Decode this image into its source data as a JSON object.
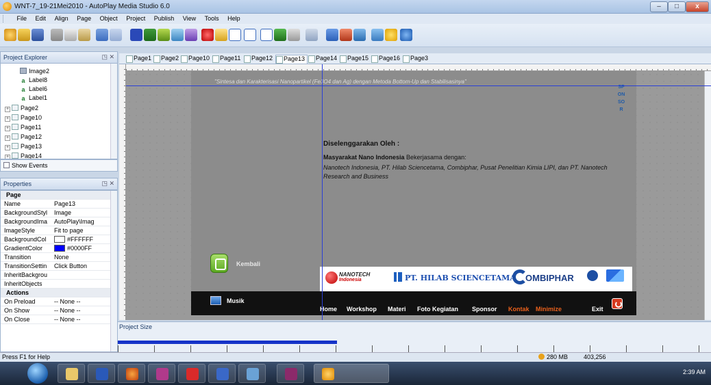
{
  "window": {
    "title": "WNT-7_19-21Mei2010 - AutoPlay Media Studio 6.0",
    "minimize": "–",
    "maximize": "□",
    "close": "x"
  },
  "menu": [
    "File",
    "Edit",
    "Align",
    "Page",
    "Object",
    "Project",
    "Publish",
    "View",
    "Tools",
    "Help"
  ],
  "explorer": {
    "title": "Project Explorer",
    "items": [
      "Image2",
      "Label8",
      "Label6",
      "Label1",
      "Page2",
      "Page10",
      "Page11",
      "Page12",
      "Page13",
      "Page14"
    ],
    "show_events": "Show Events"
  },
  "properties": {
    "title": "Properties",
    "section_page": "Page",
    "rows": [
      {
        "k": "Name",
        "v": "Page13"
      },
      {
        "k": "BackgroundStyl",
        "v": "Image"
      },
      {
        "k": "BackgroundIma",
        "v": "AutoPlay\\Imag"
      },
      {
        "k": "ImageStyle",
        "v": "Fit to page"
      },
      {
        "k": "BackgroundCol",
        "v": "#FFFFFF"
      },
      {
        "k": "GradientColor",
        "v": "#0000FF"
      },
      {
        "k": "Transition",
        "v": "None"
      },
      {
        "k": "TransitionSettin",
        "v": "Click Button"
      },
      {
        "k": "InheritBackgrou",
        "v": ""
      },
      {
        "k": "InheritObjects",
        "v": ""
      }
    ],
    "section_actions": "Actions",
    "actions": [
      {
        "k": "On Preload",
        "v": "-- None --"
      },
      {
        "k": "On Show",
        "v": "-- None --"
      },
      {
        "k": "On Close",
        "v": "-- None --"
      }
    ],
    "bg_color": "#FFFFFF",
    "gradient_color": "#0000FF"
  },
  "tabs": [
    "Page1",
    "Page2",
    "Page10",
    "Page11",
    "Page12",
    "Page13",
    "Page14",
    "Page15",
    "Page16",
    "Page3"
  ],
  "active_tab": "Page13",
  "page": {
    "subtitle": "\"Sintesa dan Karakterisasi Nanopartikel (Fe3O4 dan Ag) dengan Metoda Bottom-Up dan Stabilisasinya\"",
    "sponsor_vertical": "SPONSOR",
    "organized_by": "Diselenggarakan Oleh :",
    "org_name": "Masyarakat  Nano Indonesia",
    "org_with": " Bekerjasama dengan:",
    "org_partners": "Nanotech Indonesia, PT. Hilab Sciencetama, Combiphar, Pusat Penelitian Kimia LIPI, dan PT. Nanotech Research and Business",
    "back_label": "Kembali",
    "music_label": "Musik",
    "logo_nanotech": "NANOTECH",
    "logo_nanotech_sub": "Indonesia",
    "logo_hilab": "PT. HILAB SCIENCETAMA",
    "logo_combiphar": "OMBIPHAR",
    "nav": [
      {
        "label": "Home",
        "alt": false
      },
      {
        "label": "Workshop",
        "alt": false
      },
      {
        "label": "Materi",
        "alt": false
      },
      {
        "label": "Foto Kegiatan",
        "alt": false
      },
      {
        "label": "Sponsor",
        "alt": false
      },
      {
        "label": "Kontak",
        "alt": true
      },
      {
        "label": "Minimize",
        "alt": true
      },
      {
        "label": "Exit",
        "alt": false
      }
    ]
  },
  "project_size": {
    "title": "Project Size",
    "used_fraction": 0.37
  },
  "status": {
    "help": "Press F1 for Help",
    "memory": "280 MB",
    "count": "403,256"
  },
  "tray": {
    "time": "2:39 AM"
  },
  "colors": {
    "accent_orange": "#e8601c",
    "guide_blue": "#2a3fd6"
  }
}
